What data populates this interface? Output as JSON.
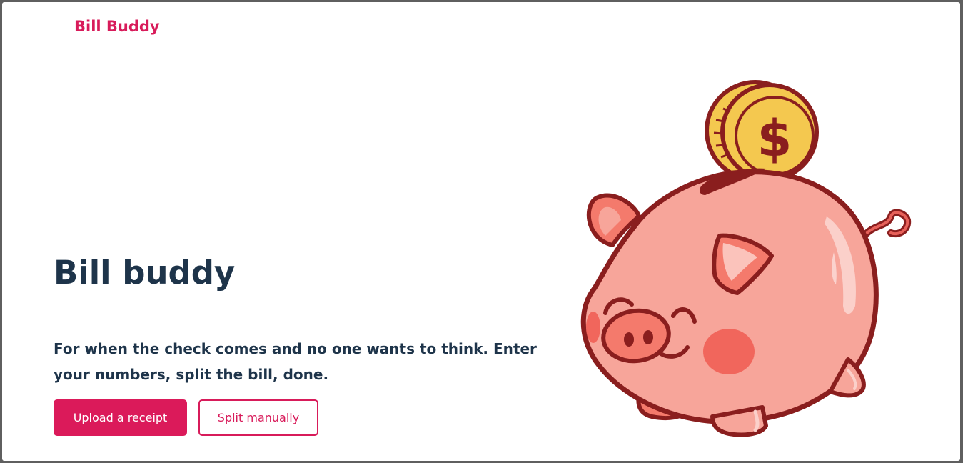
{
  "header": {
    "brand": "Bill Buddy"
  },
  "hero": {
    "title": "Bill buddy",
    "subtitle": "For when the check comes and no one wants to think. Enter your numbers, split the bill, done."
  },
  "actions": {
    "upload_label": "Upload a receipt",
    "manual_label": "Split manually"
  },
  "illustration": {
    "icon": "piggy-bank-with-coin-icon"
  },
  "colors": {
    "brand": "#d81b5a",
    "text": "#1e344a",
    "pig": "#f7a59a",
    "coin": "#f4c84f",
    "outline": "#8a1e1e"
  }
}
